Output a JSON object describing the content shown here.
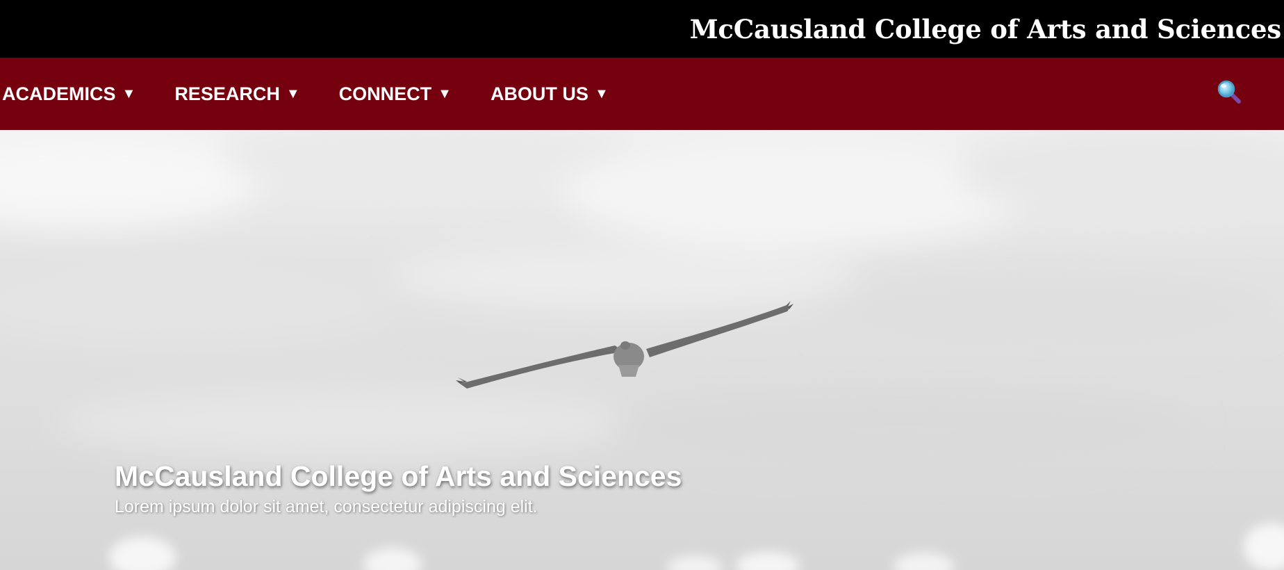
{
  "header": {
    "site_title": "McCausland College of Arts and Sciences"
  },
  "nav": {
    "items": [
      {
        "label": "ACADEMICS",
        "caret": "▼"
      },
      {
        "label": "RESEARCH",
        "caret": "▼"
      },
      {
        "label": "CONNECT",
        "caret": "▼"
      },
      {
        "label": "ABOUT US",
        "caret": "▼"
      }
    ],
    "search_icon": "search-icon"
  },
  "hero": {
    "title": "McCausland College of Arts and Sciences",
    "subtitle": "Lorem ipsum dolor sit amet, consectetur adipiscing elit.",
    "image_subject": "bird-in-flight-icon"
  },
  "colors": {
    "topbar_bg": "#000000",
    "nav_bg": "#75000e",
    "text": "#ffffff"
  }
}
